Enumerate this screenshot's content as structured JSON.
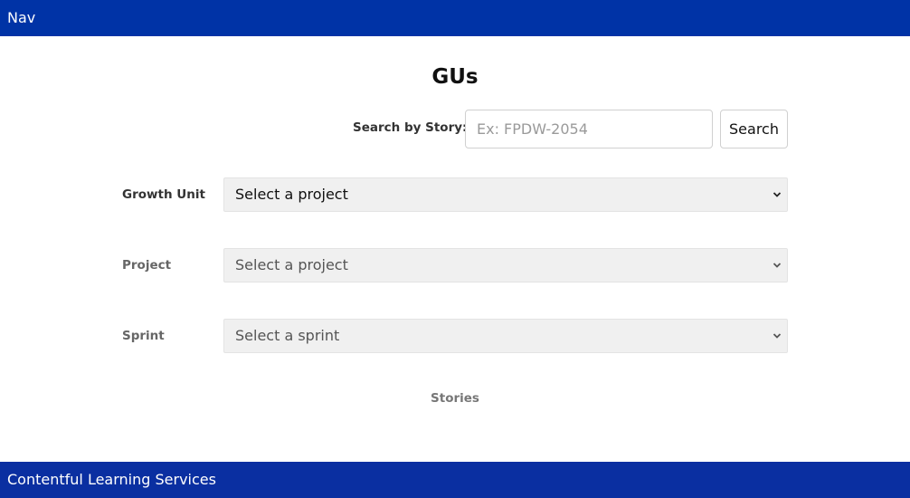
{
  "header": {
    "title": "Nav"
  },
  "main": {
    "title": "GUs",
    "search": {
      "label": "Search by Story:",
      "placeholder": "Ex: FPDW-2054",
      "value": "",
      "button_label": "Search"
    },
    "fields": [
      {
        "label": "Growth Unit",
        "selected": "Select a project",
        "enabled": true
      },
      {
        "label": "Project",
        "selected": "Select a project",
        "enabled": false
      },
      {
        "label": "Sprint",
        "selected": "Select a sprint",
        "enabled": false
      }
    ],
    "stories_label": "Stories"
  },
  "footer": {
    "text": "Contentful Learning Services"
  },
  "colors": {
    "header_bg": "#0033a6",
    "footer_bg": "#0a2fa1",
    "enabled_text": "#111111",
    "disabled_text": "#555555",
    "disabled_label": "#666666"
  },
  "icons": {
    "select_caret": "chevron-down-icon"
  }
}
